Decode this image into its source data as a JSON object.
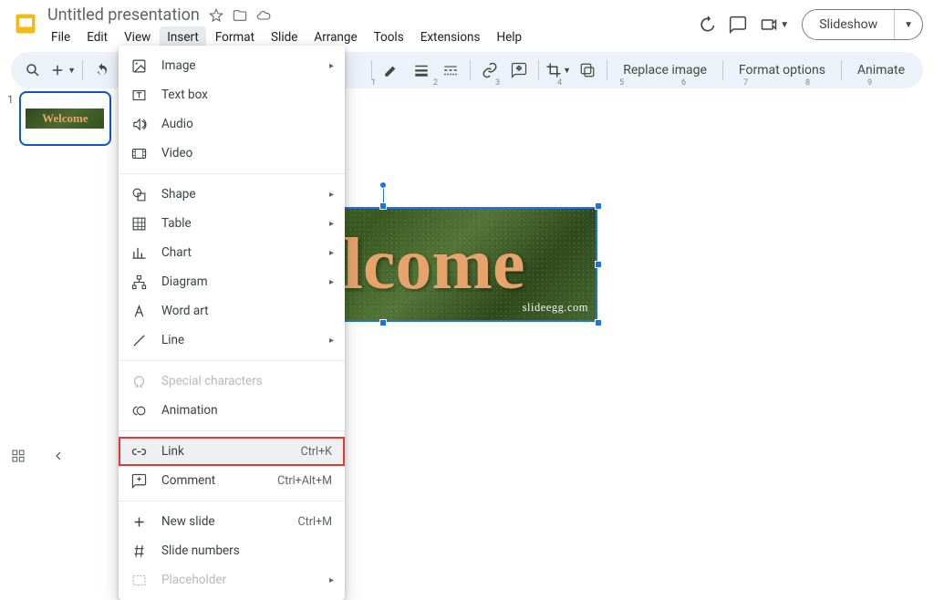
{
  "title": "Untitled presentation",
  "menus": [
    "File",
    "Edit",
    "View",
    "Insert",
    "Format",
    "Slide",
    "Arrange",
    "Tools",
    "Extensions",
    "Help"
  ],
  "active_menu_index": 3,
  "slideshow_label": "Slideshow",
  "toolbar_text": [
    "Replace image",
    "Format options",
    "Animate"
  ],
  "ruler_ticks": [
    "1",
    "2",
    "3",
    "4",
    "5",
    "6",
    "7",
    "8",
    "9"
  ],
  "thumb_number": "1",
  "slide_image_text": "Welcome",
  "slide_watermark": "slideegg.com",
  "dropdown": [
    {
      "label": "Image",
      "arrow": true
    },
    {
      "label": "Text box"
    },
    {
      "label": "Audio"
    },
    {
      "label": "Video"
    },
    {
      "sep": true
    },
    {
      "label": "Shape",
      "arrow": true
    },
    {
      "label": "Table",
      "arrow": true
    },
    {
      "label": "Chart",
      "arrow": true
    },
    {
      "label": "Diagram",
      "arrow": true
    },
    {
      "label": "Word art"
    },
    {
      "label": "Line",
      "arrow": true
    },
    {
      "sep": true
    },
    {
      "label": "Special characters",
      "disabled": true
    },
    {
      "label": "Animation"
    },
    {
      "sep": true
    },
    {
      "label": "Link",
      "shortcut": "Ctrl+K",
      "hover": true,
      "highlight": true
    },
    {
      "label": "Comment",
      "shortcut": "Ctrl+Alt+M"
    },
    {
      "sep": true
    },
    {
      "label": "New slide",
      "shortcut": "Ctrl+M"
    },
    {
      "label": "Slide numbers"
    },
    {
      "label": "Placeholder",
      "arrow": true,
      "disabled": true
    }
  ]
}
